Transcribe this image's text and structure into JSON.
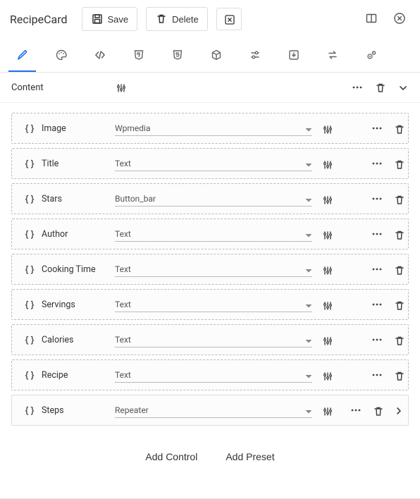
{
  "header": {
    "title": "RecipeCard",
    "save_label": "Save",
    "delete_label": "Delete"
  },
  "section": {
    "title": "Content"
  },
  "controls": [
    {
      "name": "Image",
      "type": "Wpmedia",
      "variant": "dashed"
    },
    {
      "name": "Title",
      "type": "Text",
      "variant": "dashed"
    },
    {
      "name": "Stars",
      "type": "Button_bar",
      "variant": "dashed"
    },
    {
      "name": "Author",
      "type": "Text",
      "variant": "dashed"
    },
    {
      "name": "Cooking Time",
      "type": "Text",
      "variant": "dashed"
    },
    {
      "name": "Servings",
      "type": "Text",
      "variant": "dashed"
    },
    {
      "name": "Calories",
      "type": "Text",
      "variant": "dashed"
    },
    {
      "name": "Recipe",
      "type": "Text",
      "variant": "dashed"
    },
    {
      "name": "Steps",
      "type": "Repeater",
      "variant": "solid",
      "expandable": true
    }
  ],
  "bottom": {
    "add_control": "Add Control",
    "add_preset": "Add Preset"
  },
  "icons": {
    "save": "save-icon",
    "delete": "trash-icon",
    "close_square": "close-square-icon",
    "panel": "panel-icon",
    "close_circle": "close-circle-icon",
    "tabs": [
      "pencil",
      "palette",
      "code",
      "css3",
      "html5",
      "cube",
      "sliders",
      "download-box",
      "transfer",
      "gears"
    ]
  }
}
